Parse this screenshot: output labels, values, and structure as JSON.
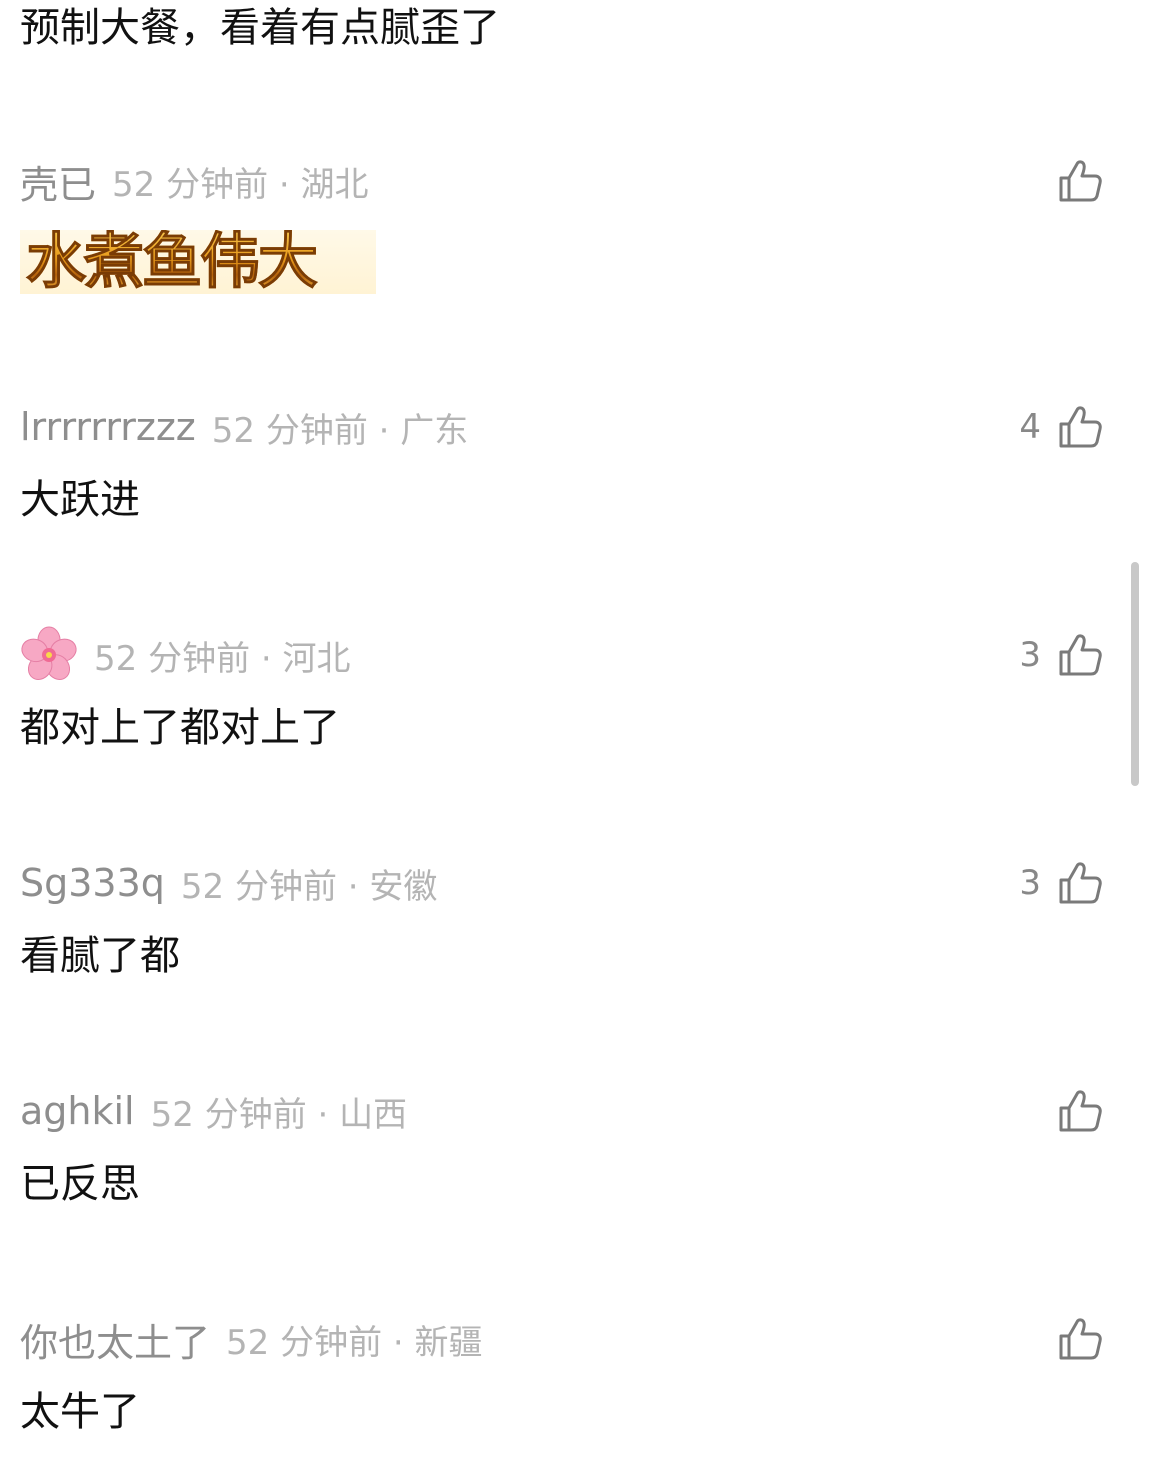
{
  "top_partial_text": "预制大餐，看着有点腻歪了",
  "comments": [
    {
      "username": "壳已",
      "time_location": "52 分钟前 · 湖北",
      "body": "",
      "sticker_text": "水煮鱼伟大",
      "likes": ""
    },
    {
      "username": "lrrrrrrrzzz",
      "time_location": "52 分钟前 · 广东",
      "body": "大跃进",
      "likes": "4"
    },
    {
      "username": "",
      "avatar_icon": "cherry-blossom-icon",
      "time_location": "52 分钟前 · 河北",
      "body": "都对上了都对上了",
      "likes": "3"
    },
    {
      "username": "Sg333q",
      "time_location": "52 分钟前 · 安徽",
      "body": "看腻了都",
      "likes": "3"
    },
    {
      "username": "aghkil",
      "time_location": "52 分钟前 · 山西",
      "body": "已反思",
      "likes": ""
    },
    {
      "username": "你也太土了",
      "time_location": "52 分钟前 · 新疆",
      "body": "太牛了",
      "likes": ""
    }
  ],
  "colors": {
    "username": "#8e8e8e",
    "meta": "#b4b4b4",
    "body": "#111111",
    "icon": "#7a7a7a"
  }
}
